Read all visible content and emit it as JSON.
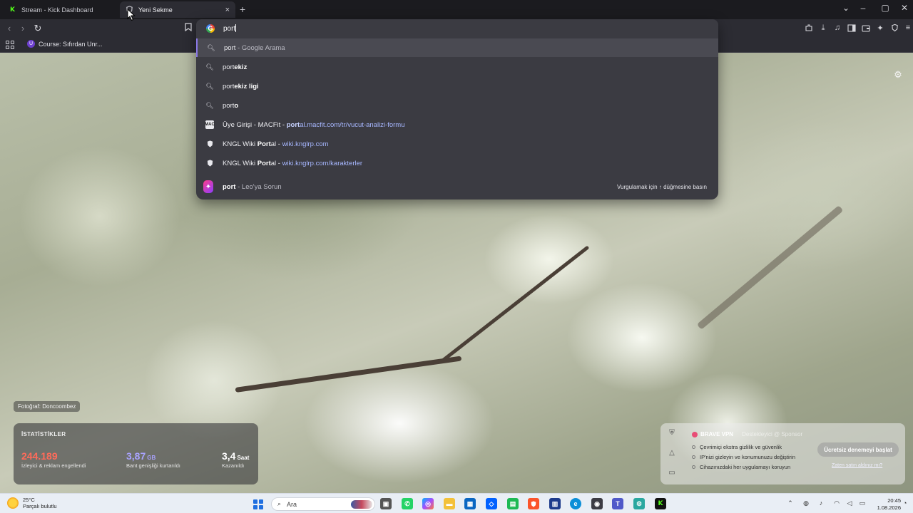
{
  "tabs": [
    {
      "title": "Stream - Kick Dashboard",
      "favicon": "kick-icon"
    },
    {
      "title": "Yeni Sekme",
      "favicon": "brave-icon",
      "active": true
    }
  ],
  "tab_close_glyph": "×",
  "new_tab_glyph": "+",
  "window_controls": {
    "dropdown": "⌄",
    "minimize": "–",
    "maximize": "▢",
    "close": "✕"
  },
  "toolbar": {
    "back": "‹",
    "forward": "›",
    "reload": "↻",
    "bookmark": "🔖"
  },
  "bookmarks": [
    {
      "label": "Course: Sıfırdan Unr...",
      "icon_letter": "U"
    }
  ],
  "omnibox": {
    "typed": "port",
    "engine_icon_letter": "G",
    "suggestions": [
      {
        "type": "search",
        "bold": "port",
        "rest": "",
        "gray": " - Google Arama",
        "highlighted": true
      },
      {
        "type": "search",
        "prefix": "port",
        "bold": "ekiz",
        "rest": ""
      },
      {
        "type": "search",
        "prefix": "port",
        "bold": "ekiz ligi",
        "rest": ""
      },
      {
        "type": "search",
        "prefix": "port",
        "bold": "o",
        "rest": ""
      },
      {
        "type": "history",
        "title": "Üye Girişi - MACFit",
        "sep": " - ",
        "url_bold": "port",
        "url_rest": "al.macfit.com/tr/vucut-analizi-formu",
        "icon_text": "MAC"
      },
      {
        "type": "history",
        "title_pre": "KNGL Wiki ",
        "title_bold": "Port",
        "title_post": "al",
        "sep": " - ",
        "url_rest": "wiki.knglrp.com"
      },
      {
        "type": "history",
        "title_pre": "KNGL Wiki ",
        "title_bold": "Port",
        "title_post": "al",
        "sep": " - ",
        "url_rest": "wiki.knglrp.com/karakterler"
      },
      {
        "type": "leo",
        "bold": "port",
        "gray": " - Leo'ya Sorun",
        "hint": "Vurgulamak için ↑ düğmesine basın"
      }
    ]
  },
  "ntp": {
    "photo_credit": "Fotoğraf: Doncoombez",
    "stats": {
      "title": "İSTATİSTİKLER",
      "items": [
        {
          "value": "244.189",
          "unit": "",
          "label": "İzleyici & reklam engellendi"
        },
        {
          "value": "3,87",
          "unit": "GB",
          "label": "Bant genişliği kurtarıldı"
        },
        {
          "value": "3,4",
          "unit": "Saat",
          "label": "Kazanıldı"
        }
      ]
    },
    "vpn": {
      "brand": "BRAVE VPN",
      "brand_sub": "Destekleyici @ Sponsor",
      "features": [
        "Çevrimiçi ekstra gizlilik ve güvenlik",
        "IP'nizi gizleyin ve konumunuzu değiştirin",
        "Cihazınızdaki her uygulamayı koruyun"
      ],
      "cta": "Ücretsiz denemeyi başlat",
      "already": "Zaten satın aldınız mı?"
    }
  },
  "taskbar": {
    "temp": "25°C",
    "weather": "Parçalı bulutlu",
    "search_placeholder": "Ara",
    "time": "20:45",
    "date": "1.08.2026"
  },
  "colors": {
    "accent": "#8a78e6",
    "stat_red": "#ff6b5a",
    "stat_purple": "#a9a3ff",
    "kick_green": "#53fc18"
  }
}
